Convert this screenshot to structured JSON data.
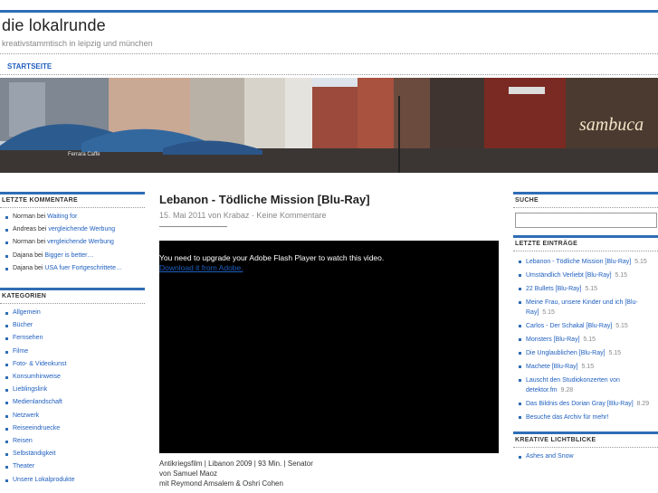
{
  "site": {
    "title": "die lokalrunde",
    "description": "kreativstammtisch in leipzig und münchen"
  },
  "nav": {
    "items": [
      {
        "label": "STARTSEITE"
      }
    ]
  },
  "header_image": {
    "signs": [
      "Ferrara Caffe",
      "sambuca"
    ]
  },
  "left_sidebar": {
    "recent_comments": {
      "title": "LETZTE KOMMENTARE",
      "items": [
        {
          "author": "Norman",
          "sep": " bei ",
          "link": "Waiting for"
        },
        {
          "author": "Andreas",
          "sep": " bei ",
          "link": "vergleichende Werbung"
        },
        {
          "author": "Norman",
          "sep": " bei ",
          "link": "vergleichende Werbung"
        },
        {
          "author": "Dajana",
          "sep": " bei ",
          "link": "Bigger is better…"
        },
        {
          "author": "Dajana",
          "sep": " bei ",
          "link": "USA fuer Fortgeschrittete…"
        }
      ]
    },
    "categories": {
      "title": "KATEGORIEN",
      "items": [
        "Allgemein",
        "Bücher",
        "Fernsehen",
        "Filme",
        "Foto- & Videokunst",
        "Konsumhinweise",
        "Lieblingslink",
        "Medienlandschaft",
        "Netzwerk",
        "Reiseeindruecke",
        "Reisen",
        "Selbständigkeit",
        "Theater",
        "Unsere Lokalprodukte"
      ]
    }
  },
  "post": {
    "title": "Lebanon - Tödliche Mission [Blu-Ray]",
    "date": "15. Mai 2011",
    "by": " von ",
    "author": "Krabaz",
    "separator": " · ",
    "comments": "Keine Kommentare",
    "video": {
      "message": "You need to upgrade your Adobe Flash Player to watch this video.",
      "link": "Download it from Adobe."
    },
    "info_lines": [
      "Antikriegsfilm | Libanon 2009 | 93 Min. | Senator",
      "von Samuel Maoz",
      "mit Reymond Amsalem & Oshri Cohen"
    ]
  },
  "right_sidebar": {
    "search": {
      "title": "SUCHE",
      "value": ""
    },
    "recent_entries": {
      "title": "LETZTE EINTRÄGE",
      "items": [
        {
          "label": "Lebanon - Tödliche Mission [Blu-Ray]",
          "date": "5.15"
        },
        {
          "label": "Umständlich Verliebt [Blu-Ray]",
          "date": "5.15"
        },
        {
          "label": "22 Bullets [Blu-Ray]",
          "date": "5.15"
        },
        {
          "label": "Meine Frau, unsere Kinder und ich [Blu-Ray]",
          "date": "5.15"
        },
        {
          "label": "Carlos - Der Schakal [Blu-Ray]",
          "date": "5.15"
        },
        {
          "label": "Monsters [Blu-Ray]",
          "date": "5.15"
        },
        {
          "label": "Die Unglaublichen [Blu-Ray]",
          "date": "5.15"
        },
        {
          "label": "Machete [Blu-Ray]",
          "date": "5.15"
        },
        {
          "label": "Lauscht den Studiokonzerten von detektor.fm",
          "date": "9.28"
        },
        {
          "label": "Das Bildnis des Dorian Gray [Blu-Ray]",
          "date": "8.29"
        },
        {
          "label": "Besuche das Archiv für mehr!",
          "date": ""
        }
      ]
    },
    "creative": {
      "title": "KREATIVE LICHTBLICKE",
      "items": [
        "Ashes and Snow"
      ]
    }
  },
  "colors": {
    "accent": "#2f6db5",
    "link": "#1f5fbf",
    "text": "#333333",
    "muted": "#888888"
  }
}
